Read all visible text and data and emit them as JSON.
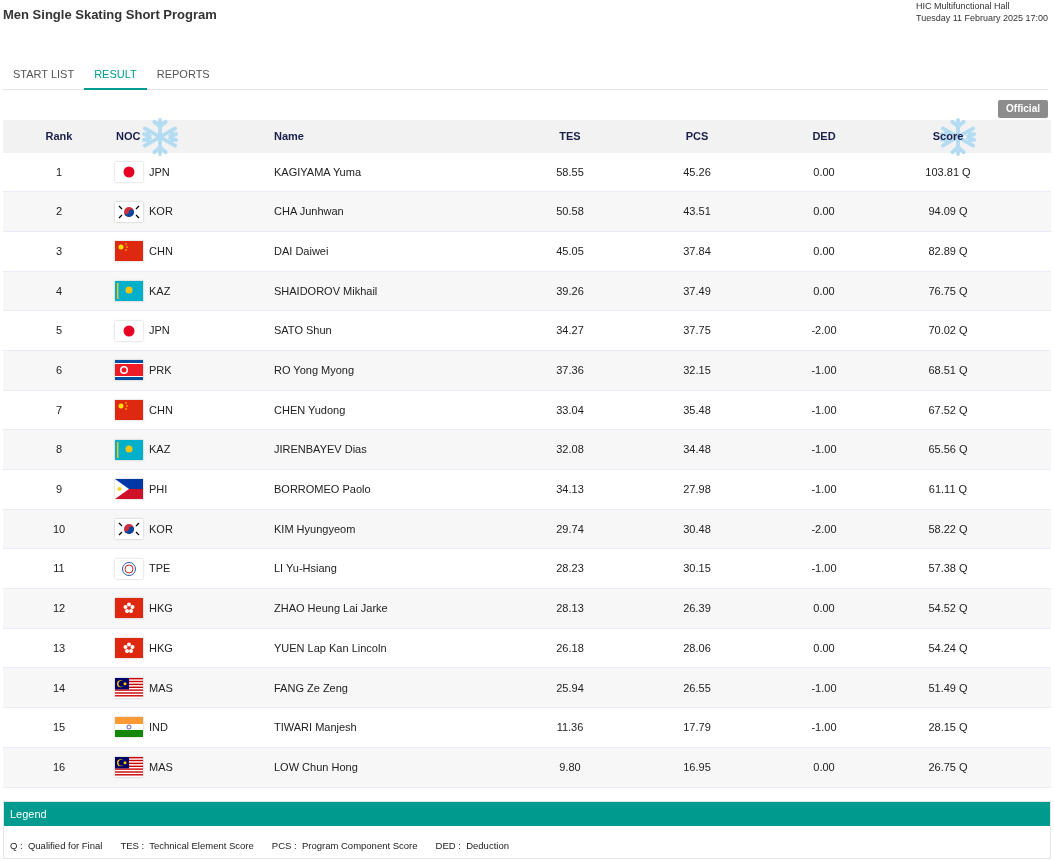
{
  "title": "Men Single Skating Short Program",
  "venue": "HIC Multifunctional Hall",
  "datetime": "Tuesday 11 February 2025 17:00",
  "tabs": [
    {
      "label": "START LIST",
      "selected": false
    },
    {
      "label": "RESULT",
      "selected": true
    },
    {
      "label": "REPORTS",
      "selected": false
    }
  ],
  "status_badge": "Official",
  "table": {
    "columns": [
      "Rank",
      "NOC",
      "Name",
      "TES",
      "PCS",
      "DED",
      "Score"
    ],
    "rows": [
      {
        "rank": "1",
        "kind": "jp",
        "noc": "JPN",
        "name": "KAGIYAMA Yuma",
        "tes": "58.55",
        "pcs": "45.26",
        "ded": "0.00",
        "score": "103.81 Q"
      },
      {
        "rank": "2",
        "kind": "kr",
        "noc": "KOR",
        "name": "CHA Junhwan",
        "tes": "50.58",
        "pcs": "43.51",
        "ded": "0.00",
        "score": "94.09 Q"
      },
      {
        "rank": "3",
        "kind": "cn",
        "noc": "CHN",
        "name": "DAI Daiwei",
        "tes": "45.05",
        "pcs": "37.84",
        "ded": "0.00",
        "score": "82.89 Q"
      },
      {
        "rank": "4",
        "kind": "kz",
        "noc": "KAZ",
        "name": "SHAIDOROV Mikhail",
        "tes": "39.26",
        "pcs": "37.49",
        "ded": "0.00",
        "score": "76.75 Q"
      },
      {
        "rank": "5",
        "kind": "jp",
        "noc": "JPN",
        "name": "SATO Shun",
        "tes": "34.27",
        "pcs": "37.75",
        "ded": "-2.00",
        "score": "70.02 Q"
      },
      {
        "rank": "6",
        "kind": "kp",
        "noc": "PRK",
        "name": "RO Yong Myong",
        "tes": "37.36",
        "pcs": "32.15",
        "ded": "-1.00",
        "score": "68.51 Q"
      },
      {
        "rank": "7",
        "kind": "cn",
        "noc": "CHN",
        "name": "CHEN Yudong",
        "tes": "33.04",
        "pcs": "35.48",
        "ded": "-1.00",
        "score": "67.52 Q"
      },
      {
        "rank": "8",
        "kind": "kz",
        "noc": "KAZ",
        "name": "JIRENBAYEV Dias",
        "tes": "32.08",
        "pcs": "34.48",
        "ded": "-1.00",
        "score": "65.56 Q"
      },
      {
        "rank": "9",
        "kind": "ph",
        "noc": "PHI",
        "name": "BORROMEO Paolo",
        "tes": "34.13",
        "pcs": "27.98",
        "ded": "-1.00",
        "score": "61.11 Q"
      },
      {
        "rank": "10",
        "kind": "kr",
        "noc": "KOR",
        "name": "KIM Hyungyeom",
        "tes": "29.74",
        "pcs": "30.48",
        "ded": "-2.00",
        "score": "58.22 Q"
      },
      {
        "rank": "11",
        "kind": "tw",
        "noc": "TPE",
        "name": "LI Yu-Hsiang",
        "tes": "28.23",
        "pcs": "30.15",
        "ded": "-1.00",
        "score": "57.38 Q"
      },
      {
        "rank": "12",
        "kind": "hk",
        "noc": "HKG",
        "name": "ZHAO Heung Lai Jarke",
        "tes": "28.13",
        "pcs": "26.39",
        "ded": "0.00",
        "score": "54.52 Q"
      },
      {
        "rank": "13",
        "kind": "hk",
        "noc": "HKG",
        "name": "YUEN Lap Kan Lincoln",
        "tes": "26.18",
        "pcs": "28.06",
        "ded": "0.00",
        "score": "54.24 Q"
      },
      {
        "rank": "14",
        "kind": "my",
        "noc": "MAS",
        "name": "FANG Ze Zeng",
        "tes": "25.94",
        "pcs": "26.55",
        "ded": "-1.00",
        "score": "51.49 Q"
      },
      {
        "rank": "15",
        "kind": "in",
        "noc": "IND",
        "name": "TIWARI Manjesh",
        "tes": "11.36",
        "pcs": "17.79",
        "ded": "-1.00",
        "score": "28.15 Q"
      },
      {
        "rank": "16",
        "kind": "my",
        "noc": "MAS",
        "name": "LOW Chun Hong",
        "tes": "9.80",
        "pcs": "16.95",
        "ded": "0.00",
        "score": "26.75 Q"
      }
    ]
  },
  "legend": {
    "title": "Legend",
    "items": [
      "Q :  Qualified for Final",
      "TES :  Technical Element Score",
      "PCS :  Program Component Score",
      "DED :  Deduction"
    ]
  }
}
